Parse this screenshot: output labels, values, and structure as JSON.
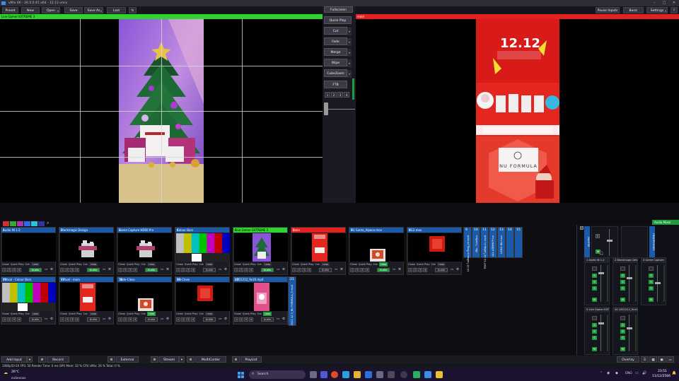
{
  "window": {
    "title": "vMix 4K - 26.0.0.45 x64 - 12.12.vmix",
    "minimize": "–",
    "maximize": "□",
    "close": "✕"
  },
  "menu": {
    "left": [
      {
        "label": "Preset",
        "dd": false
      },
      {
        "label": "New",
        "dd": false
      },
      {
        "label": "Open",
        "dd": true
      },
      {
        "label": "Save",
        "dd": false
      },
      {
        "label": "Save As",
        "dd": true
      },
      {
        "label": "Last",
        "dd": false
      }
    ],
    "refresh_icon": "refresh-icon",
    "right": [
      {
        "label": "Pause Inputs"
      },
      {
        "label": "Basic"
      },
      {
        "label": "Settings"
      },
      {
        "label": "?"
      }
    ]
  },
  "preview": {
    "label": "Live Gamer EXTREME 3"
  },
  "program": {
    "label": "main"
  },
  "transitions": {
    "fullscreen": "Fullscreen",
    "quick_play": "Quick Play",
    "buttons": [
      "Cut",
      "Fade",
      "Merge",
      "Wipe",
      "CubeZoom"
    ],
    "ftb": "FTB",
    "stingers": [
      "1",
      "2",
      "3",
      "4"
    ]
  },
  "colors": {
    "preview": "#2fd42f",
    "program": "#e42020",
    "tile_header": "#1a5aa8",
    "active_green": "#1e9c3a"
  },
  "tile_controls": {
    "close": "Close",
    "quick_play": "Quick Play",
    "cut": "Cut",
    "loop": "Loop",
    "audio": "Audio",
    "nums": [
      "1",
      "2",
      "3",
      "4"
    ]
  },
  "tiles": [
    {
      "num": "1",
      "title": "Audio IN 1-2",
      "thumb": "audio",
      "audio_on": true,
      "loop": false,
      "hdr": "#1a5aa8"
    },
    {
      "num": "2",
      "title": "Blackmagic Design",
      "thumb": "device",
      "audio_on": true,
      "loop": false,
      "hdr": "#1a5aa8"
    },
    {
      "num": "3",
      "title": "Game Capture HD60 Pro",
      "thumb": "device",
      "audio_on": true,
      "loop": false,
      "hdr": "#1a5aa8"
    },
    {
      "num": "4",
      "title": "Colour Bars",
      "thumb": "bars",
      "audio_on": false,
      "loop": false,
      "hdr": "#1a5aa8"
    },
    {
      "num": "5",
      "title": "Live Gamer EXTREME 3",
      "thumb": "tree",
      "audio_on": true,
      "loop": false,
      "hdr": "#2fd42f"
    },
    {
      "num": "6",
      "title": "main",
      "thumb": "red",
      "audio_on": false,
      "loop": false,
      "hdr": "#e42020"
    },
    {
      "num": "7",
      "title": "BG Santa_Alpaca.mov",
      "thumb": "santa",
      "audio_on": true,
      "loop": true,
      "hdr": "#1a5aa8"
    },
    {
      "num": "8",
      "title": "BG2.mov",
      "thumb": "redsmall",
      "audio_on": false,
      "loop": false,
      "hdr": "#1a5aa8"
    },
    {
      "num": "16",
      "title": "Virtual - Colour Bars",
      "thumb": "bars",
      "audio_on": false,
      "loop": false,
      "hdr": "#1a5aa8"
    },
    {
      "num": "17",
      "title": "Virtual - main",
      "thumb": "red",
      "audio_on": false,
      "loop": false,
      "hdr": "#1a5aa8"
    },
    {
      "num": "18",
      "title": "Table-Close",
      "thumb": "santa",
      "audio_on": false,
      "loop": true,
      "hdr": "#1a5aa8"
    },
    {
      "num": "19",
      "title": "BG-Close",
      "thumb": "redsmall",
      "audio_on": false,
      "loop": false,
      "hdr": "#1a5aa8"
    },
    {
      "num": "20",
      "title": "LZD1212_9x16.mp4",
      "thumb": "lzd",
      "audio_on": false,
      "loop": true,
      "hdr": "#1a5aa8"
    }
  ],
  "vtiles": [
    {
      "num": "9",
      "text": "12.12 ไลฟ์สดแจกใหญ่_ok.mp4"
    },
    {
      "num": "10",
      "text": "เพิ่ม - ไม่เปลี่ยน"
    },
    {
      "num": "11",
      "text": "TEXT 12.12 ไลฟ์สด.m..mp4"
    },
    {
      "num": "12",
      "text": "ALL ADMIN Price"
    },
    {
      "num": "13",
      "text": "LOGO-NU.mov"
    },
    {
      "num": "14",
      "text": ""
    },
    {
      "num": "15",
      "text": ""
    },
    {
      "num": "21",
      "text": "2021 12 0_NU FORMULA_9.mp4"
    }
  ],
  "mixer": {
    "title": "Audio Mixer",
    "master": "MASTER",
    "headphones": "HEADPHONES",
    "strips": [
      {
        "num": "1",
        "label": "Audio IN 1-2"
      },
      {
        "num": "2",
        "label": "Blackmagic Design"
      },
      {
        "num": "3",
        "label": "Game Capture"
      },
      {
        "num": "5",
        "label": "Live Gamer EXT"
      },
      {
        "num": "20",
        "label": "LZD1212_9x16"
      }
    ],
    "m": "M",
    "s": "S"
  },
  "bottom": {
    "add_input": "Add Input",
    "record": "Record",
    "external": "External",
    "stream": "Stream",
    "multicorder": "MultiCorder",
    "playlist": "PlayList",
    "overlay": "Overlay"
  },
  "status": "1080p50   EX  FPS: 50  Render Time: 0 ms  GPU Mem: 32 %  CPU vMix: 26 %  Total: 0 %",
  "taskbar": {
    "weather_temp": "26°C",
    "weather_desc": "ฝนนิดหน่อย",
    "search": "Search",
    "lang": "ENG",
    "time": "23:51",
    "date": "11/12/2566"
  },
  "swatches": [
    "#cc3333",
    "#33aa33",
    "#aa33aa",
    "#2b6be6",
    "#2bc4d6",
    "#333399"
  ]
}
